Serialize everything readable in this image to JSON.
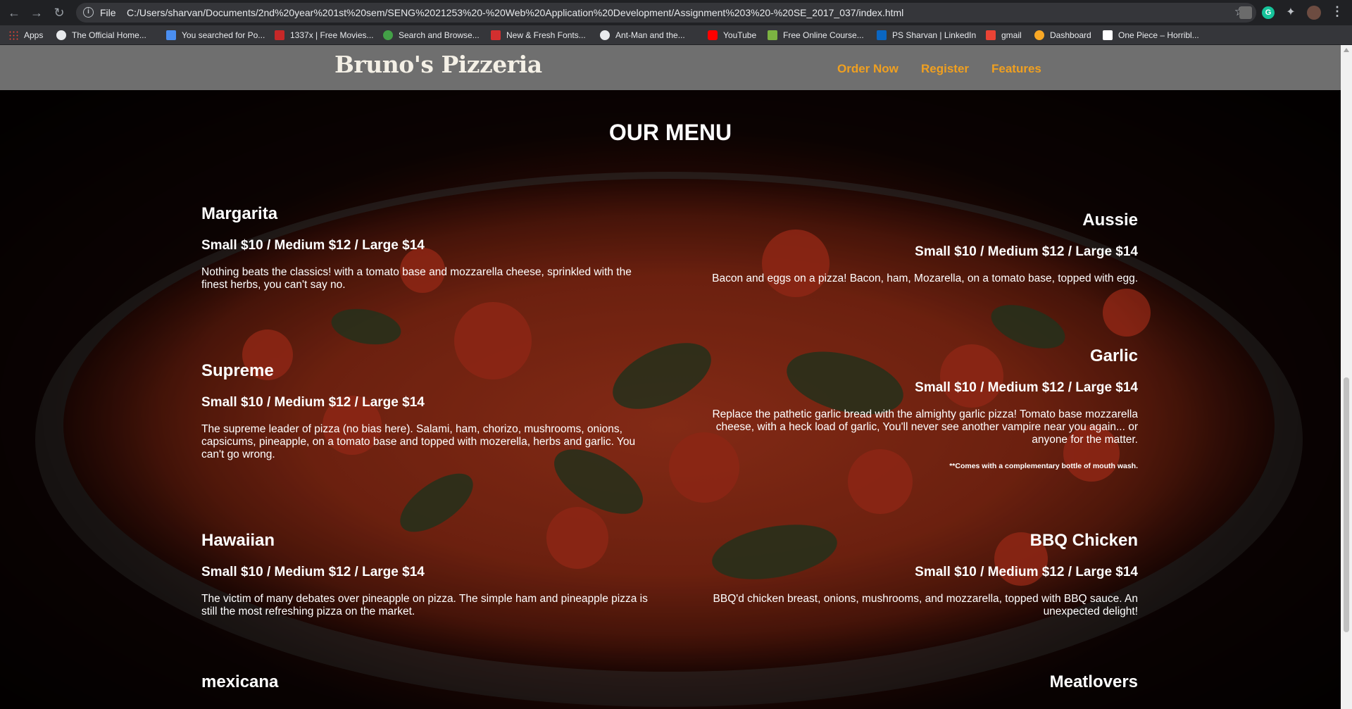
{
  "browser": {
    "file_label": "File",
    "url": "C:/Users/sharvan/Documents/2nd%20year%201st%20sem/SENG%2021253%20-%20Web%20Application%20Development/Assignment%203%20-%20SE_2017_037/index.html",
    "bookmarks": [
      {
        "label": "Apps",
        "icon": "apps-grid-icon"
      },
      {
        "label": "The Official Home...",
        "icon": "globe-icon"
      },
      {
        "label": "You searched for Po...",
        "icon": "wave-icon"
      },
      {
        "label": "1337x | Free Movies...",
        "icon": "x-icon"
      },
      {
        "label": "Search and Browse...",
        "icon": "leaf-icon"
      },
      {
        "label": "New & Fresh Fonts...",
        "icon": "font-icon"
      },
      {
        "label": "Ant-Man and the...",
        "icon": "globe-icon"
      },
      {
        "label": "YouTube",
        "icon": "youtube-icon"
      },
      {
        "label": "Free Online Course...",
        "icon": "course-icon"
      },
      {
        "label": "PS Sharvan | LinkedIn",
        "icon": "linkedin-icon"
      },
      {
        "label": "gmail",
        "icon": "gmail-icon"
      },
      {
        "label": "Dashboard",
        "icon": "dashboard-icon"
      },
      {
        "label": "One Piece – Horribl...",
        "icon": "page-icon"
      }
    ]
  },
  "site": {
    "logo": "Bruno's Pizzeria",
    "nav": [
      "Order Now",
      "Register",
      "Features"
    ],
    "accent_color": "#f0a020"
  },
  "menu": {
    "title": "OUR MENU",
    "items": [
      {
        "name": "Margarita",
        "price": "Small $10 / Medium $12 / Large $14",
        "desc": "Nothing beats the classics! with a tomato base and mozzarella cheese, sprinkled with the finest herbs, you can't say no."
      },
      {
        "name": "Aussie",
        "price": "Small $10 / Medium $12 / Large $14",
        "desc": "Bacon and eggs on a pizza! Bacon, ham, Mozarella, on a tomato base, topped with egg."
      },
      {
        "name": "Supreme",
        "price": "Small $10 / Medium $12 / Large $14",
        "desc": "The supreme leader of pizza (no bias here). Salami, ham, chorizo, mushrooms, onions, capsicums, pineapple, on a tomato base and topped with mozerella, herbs and garlic. You can't go wrong."
      },
      {
        "name": "Garlic",
        "price": "Small $10 / Medium $12 / Large $14",
        "desc": "Replace the pathetic garlic bread with the almighty garlic pizza! Tomato base mozzarella cheese, with a heck load of garlic, You'll never see another vampire near you again... or anyone for the matter.",
        "note": "**Comes with a complementary bottle of mouth wash."
      },
      {
        "name": "Hawaiian",
        "price": "Small $10 / Medium $12 / Large $14",
        "desc": "The victim of many debates over pineapple on pizza. The simple ham and pineapple pizza is still the most refreshing pizza on the market."
      },
      {
        "name": "BBQ Chicken",
        "price": "Small $10 / Medium $12 / Large $14",
        "desc": "BBQ'd chicken breast, onions, mushrooms, and mozzarella, topped with BBQ sauce. An unexpected delight!"
      },
      {
        "name": "mexicana"
      },
      {
        "name": "Meatlovers"
      }
    ]
  }
}
